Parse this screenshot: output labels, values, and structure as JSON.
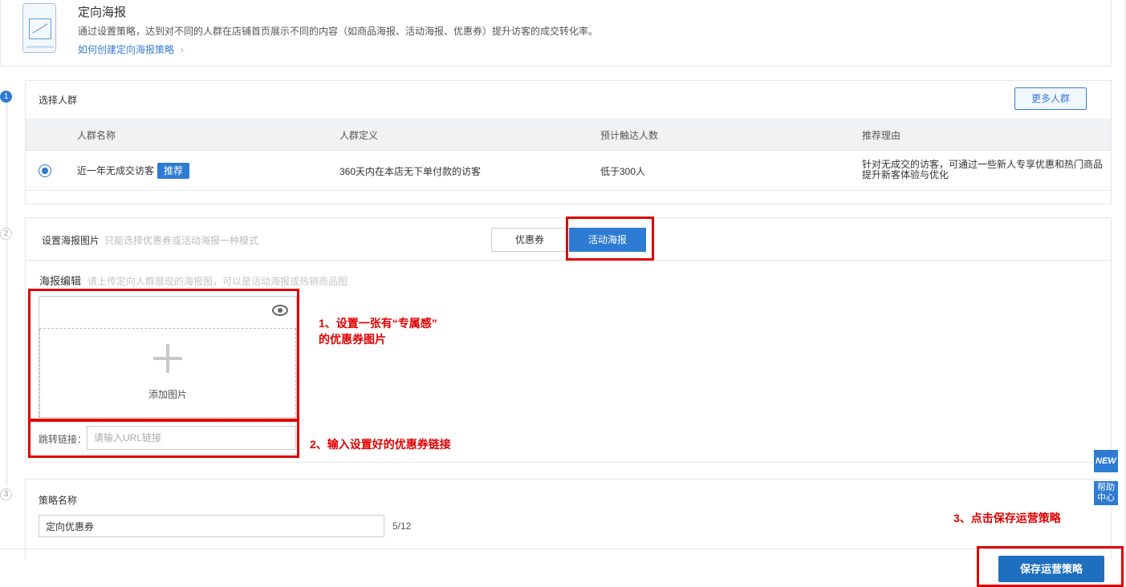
{
  "header": {
    "title": "定向海报",
    "desc": "通过设置策略，达到对不同的人群在店铺首页展示不同的内容（如商品海报、活动海报、优惠券）提升访客的成交转化率。",
    "link": "如何创建定向海报策略",
    "link_chevron": "›"
  },
  "steps": [
    "1",
    "2",
    "3"
  ],
  "crowd": {
    "title": "选择人群",
    "more_button": "更多人群",
    "columns": [
      "人群名称",
      "人群定义",
      "预计触达人数",
      "推荐理由"
    ],
    "row": {
      "name": "近一年无成交访客",
      "badge": "推荐",
      "definition": "360天内在本店无下单付款的访客",
      "reach": "低于300人",
      "reason": "针对无成交的访客，可通过一些新人专享优惠和热门商品提升新客体验与优化"
    }
  },
  "poster": {
    "title": "设置海报图片",
    "title_hint": "只能选择优惠券或活动海报一种模式",
    "mode_coupon": "优惠券",
    "mode_activity": "活动海报",
    "edit_label": "海报编辑",
    "edit_hint": "请上传定向人群展现的海报图，可以是活动海报或热销商品图",
    "add_image": "添加图片",
    "link_label": "跳转链接：",
    "link_placeholder": "请输入URL链接"
  },
  "strategy": {
    "title": "策略名称",
    "name_value": "定向优惠券",
    "count": "5/12"
  },
  "save_button": "保存运营策略",
  "annotations": {
    "a1_line1": "1、设置一张有“专属感”",
    "a1_line2": "的优惠券图片",
    "a2": "2、输入设置好的优惠券链接",
    "a3": "3、点击保存运营策略"
  },
  "side": {
    "new": "NEW",
    "help_line1": "帮助",
    "help_line2": "中心"
  },
  "colors": {
    "accent": "#2e7bd4",
    "annotation_red": "#e00000",
    "save_button": "#1f6fbf"
  }
}
